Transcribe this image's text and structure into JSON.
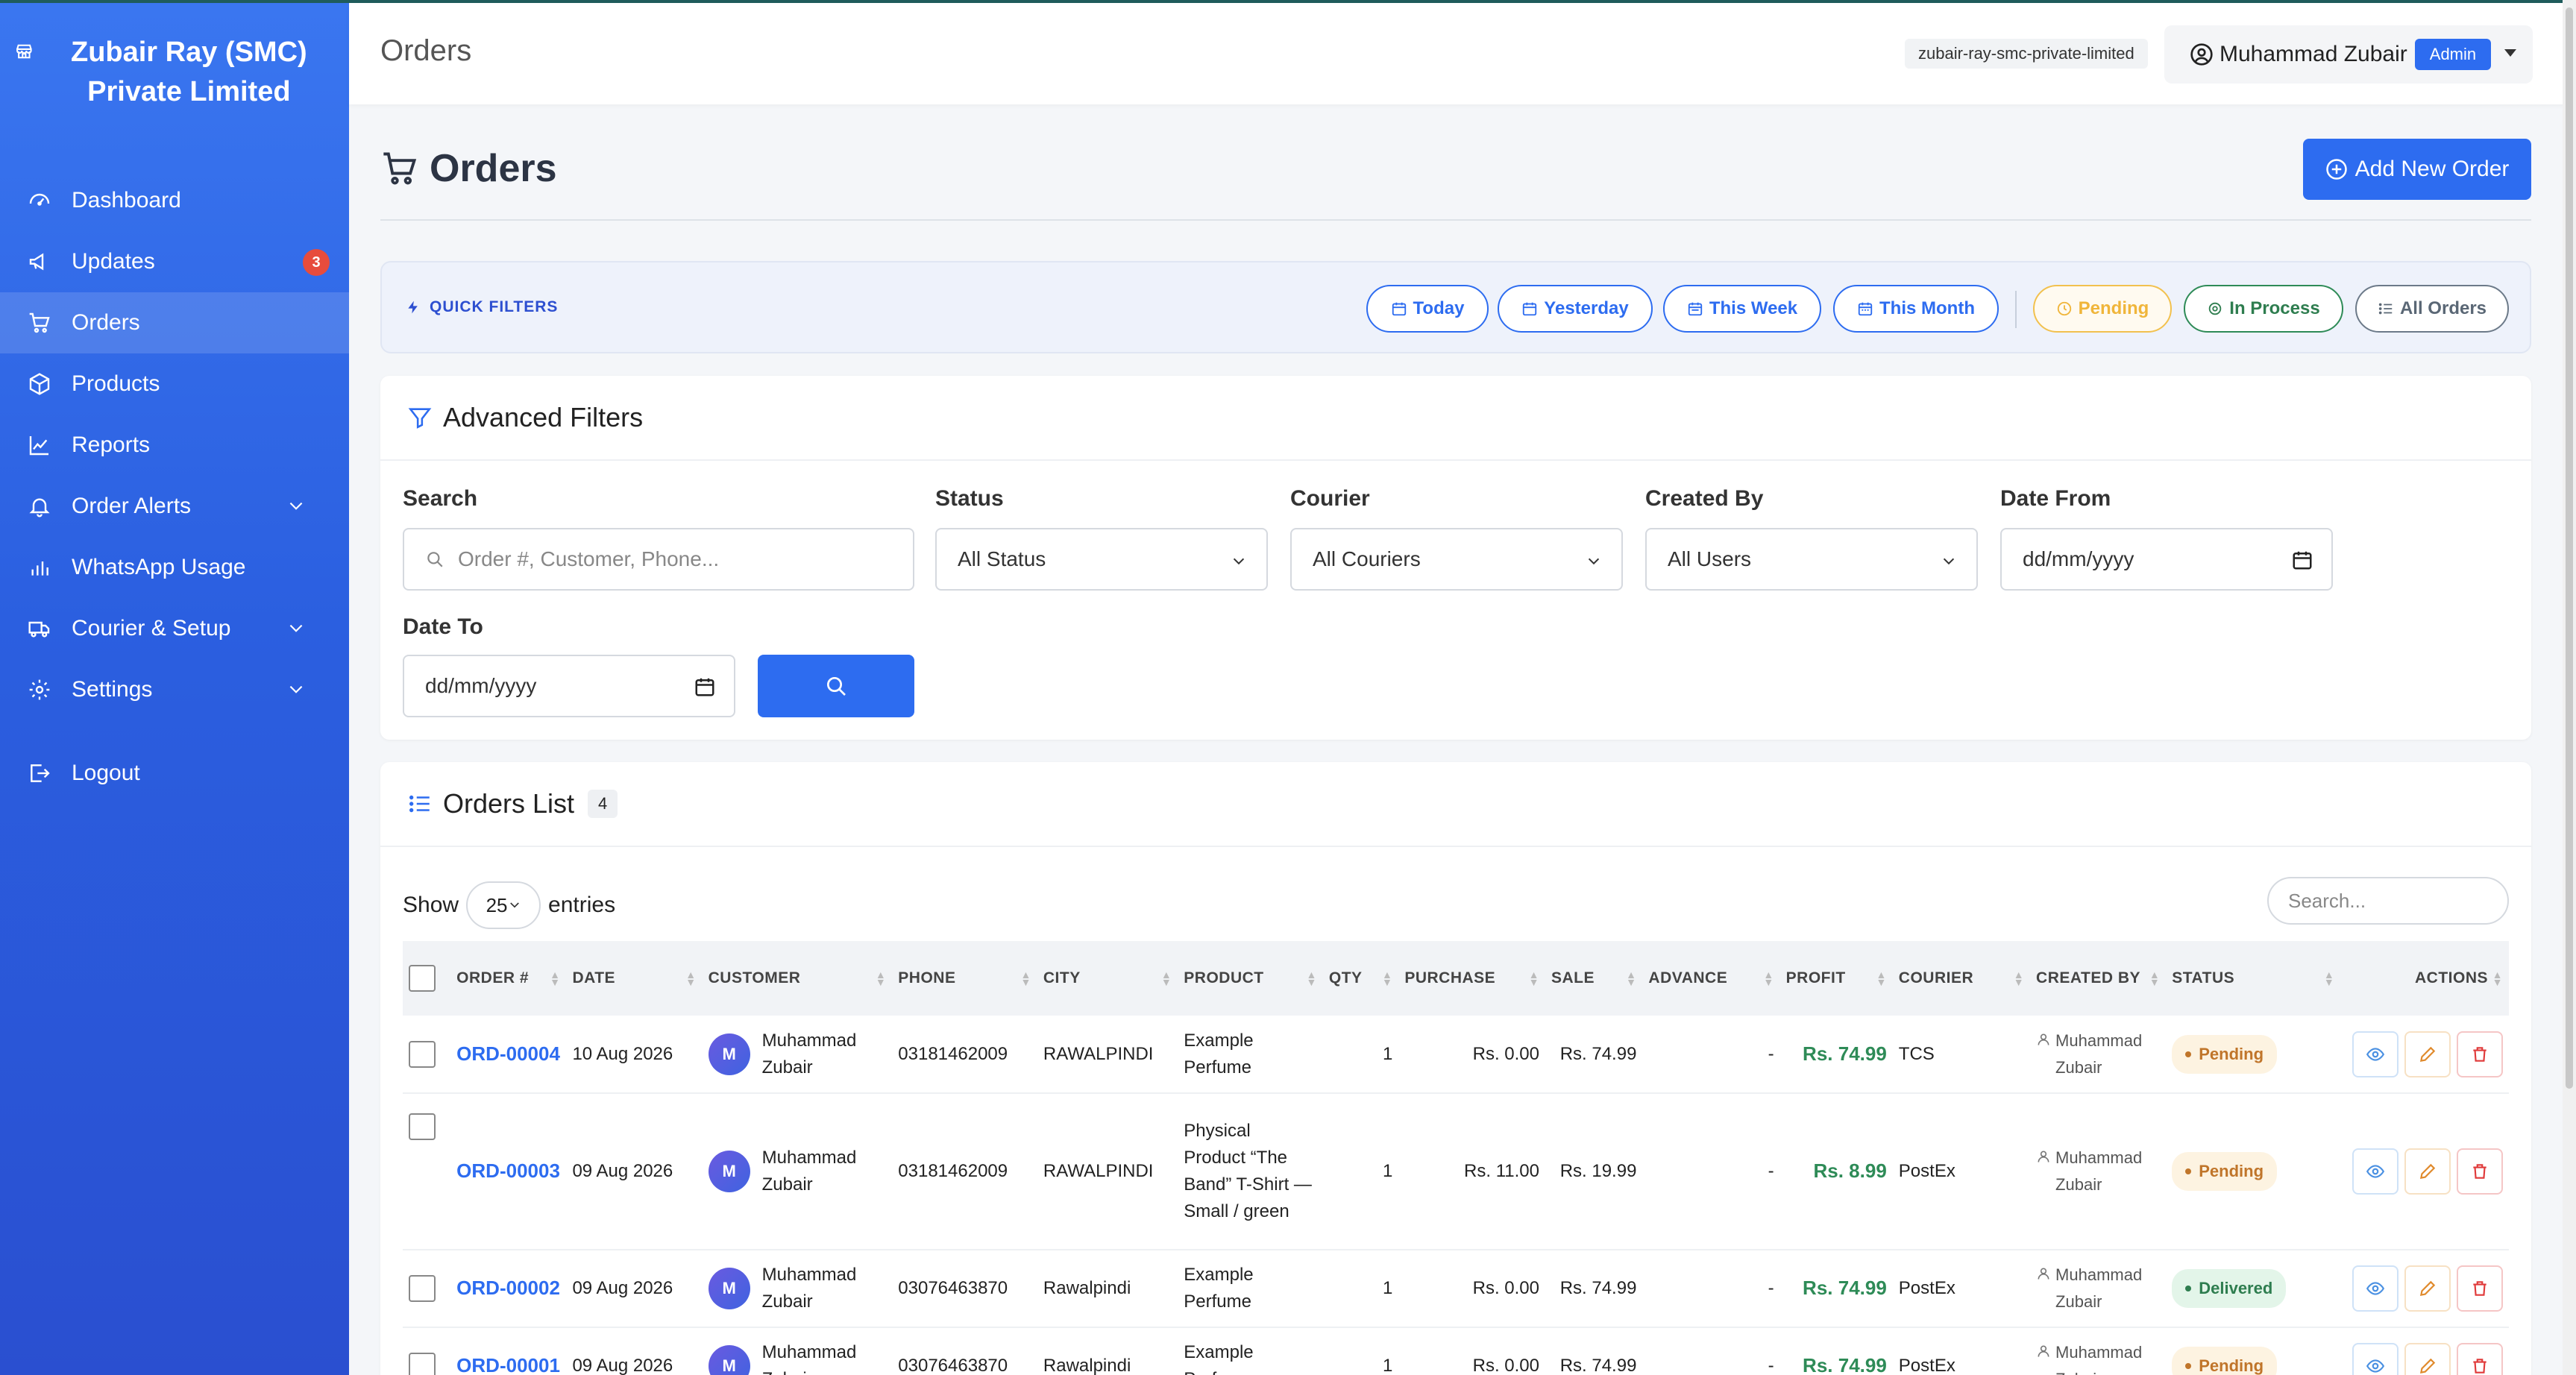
{
  "brand": {
    "name": "Zubair Ray (SMC) Private Limited"
  },
  "sidebar": {
    "items": [
      {
        "label": "Dashboard",
        "icon": "dashboard-icon"
      },
      {
        "label": "Updates",
        "icon": "megaphone-icon",
        "badge": "3"
      },
      {
        "label": "Orders",
        "icon": "cart-icon",
        "active": true
      },
      {
        "label": "Products",
        "icon": "box-icon"
      },
      {
        "label": "Reports",
        "icon": "chart-line-icon"
      },
      {
        "label": "Order Alerts",
        "icon": "bell-icon",
        "expandable": true
      },
      {
        "label": "WhatsApp Usage",
        "icon": "bar-chart-icon"
      },
      {
        "label": "Courier & Setup",
        "icon": "truck-icon",
        "expandable": true
      },
      {
        "label": "Settings",
        "icon": "gear-icon",
        "expandable": true
      },
      {
        "label": "Logout",
        "icon": "logout-icon"
      }
    ]
  },
  "header": {
    "title": "Orders",
    "tenant": "zubair-ray-smc-private-limited",
    "user_name": "Muhammad Zubair",
    "role": "Admin"
  },
  "page": {
    "title": "Orders",
    "add_button": "Add New Order"
  },
  "quick_filters": {
    "label": "QUICK FILTERS",
    "buttons": [
      "Today",
      "Yesterday",
      "This Week",
      "This Month",
      "Pending",
      "In Process",
      "All Orders"
    ]
  },
  "advanced_filters": {
    "title": "Advanced Filters",
    "search_label": "Search",
    "search_placeholder": "Order #, Customer, Phone...",
    "status_label": "Status",
    "status_value": "All Status",
    "courier_label": "Courier",
    "courier_value": "All Couriers",
    "created_by_label": "Created By",
    "created_by_value": "All Users",
    "date_from_label": "Date From",
    "date_from_value": "dd/mm/yyyy",
    "date_to_label": "Date To",
    "date_to_value": "dd/mm/yyyy"
  },
  "orders_list": {
    "title": "Orders List",
    "count": "4",
    "show_label": "Show",
    "entries_value": "25",
    "entries_label": "entries",
    "search_placeholder": "Search...",
    "columns": [
      "ORDER #",
      "DATE",
      "CUSTOMER",
      "PHONE",
      "CITY",
      "PRODUCT",
      "QTY",
      "PURCHASE",
      "SALE",
      "ADVANCE",
      "PROFIT",
      "COURIER",
      "CREATED BY",
      "STATUS",
      "ACTIONS"
    ],
    "rows": [
      {
        "order": "ORD-00004",
        "date": "10 Aug 2026",
        "avatar": "M",
        "customer": "Muhammad Zubair",
        "phone": "03181462009",
        "city": "RAWALPINDI",
        "product": "Example Perfume",
        "qty": "1",
        "purchase": "Rs. 0.00",
        "sale": "Rs. 74.99",
        "advance": "-",
        "profit": "Rs. 74.99",
        "courier": "TCS",
        "created_by": "Muhammad Zubair",
        "status": "Pending"
      },
      {
        "order": "ORD-00003",
        "date": "09 Aug 2026",
        "avatar": "M",
        "customer": "Muhammad Zubair",
        "phone": "03181462009",
        "city": "RAWALPINDI",
        "product": "Physical Product “The Band” T-Shirt — Small / green",
        "qty": "1",
        "purchase": "Rs. 11.00",
        "sale": "Rs. 19.99",
        "advance": "-",
        "profit": "Rs. 8.99",
        "courier": "PostEx",
        "created_by": "Muhammad Zubair",
        "status": "Pending"
      },
      {
        "order": "ORD-00002",
        "date": "09 Aug 2026",
        "avatar": "M",
        "customer": "Muhammad Zubair",
        "phone": "03076463870",
        "city": "Rawalpindi",
        "product": "Example Perfume",
        "qty": "1",
        "purchase": "Rs. 0.00",
        "sale": "Rs. 74.99",
        "advance": "-",
        "profit": "Rs. 74.99",
        "courier": "PostEx",
        "created_by": "Muhammad Zubair",
        "status": "Delivered"
      },
      {
        "order": "ORD-00001",
        "date": "09 Aug 2026",
        "avatar": "M",
        "customer": "Muhammad Zubair",
        "phone": "03076463870",
        "city": "Rawalpindi",
        "product": "Example Perfume",
        "qty": "1",
        "purchase": "Rs. 0.00",
        "sale": "Rs. 74.99",
        "advance": "-",
        "profit": "Rs. 74.99",
        "courier": "PostEx",
        "created_by": "Muhammad Zubair",
        "status": "Pending"
      }
    ]
  },
  "colors": {
    "primary": "#2d6cf0",
    "sidebar": "#3a76f0",
    "profit": "#2e8b57",
    "pending": "#c0752a",
    "delivered": "#2e7d4f"
  }
}
